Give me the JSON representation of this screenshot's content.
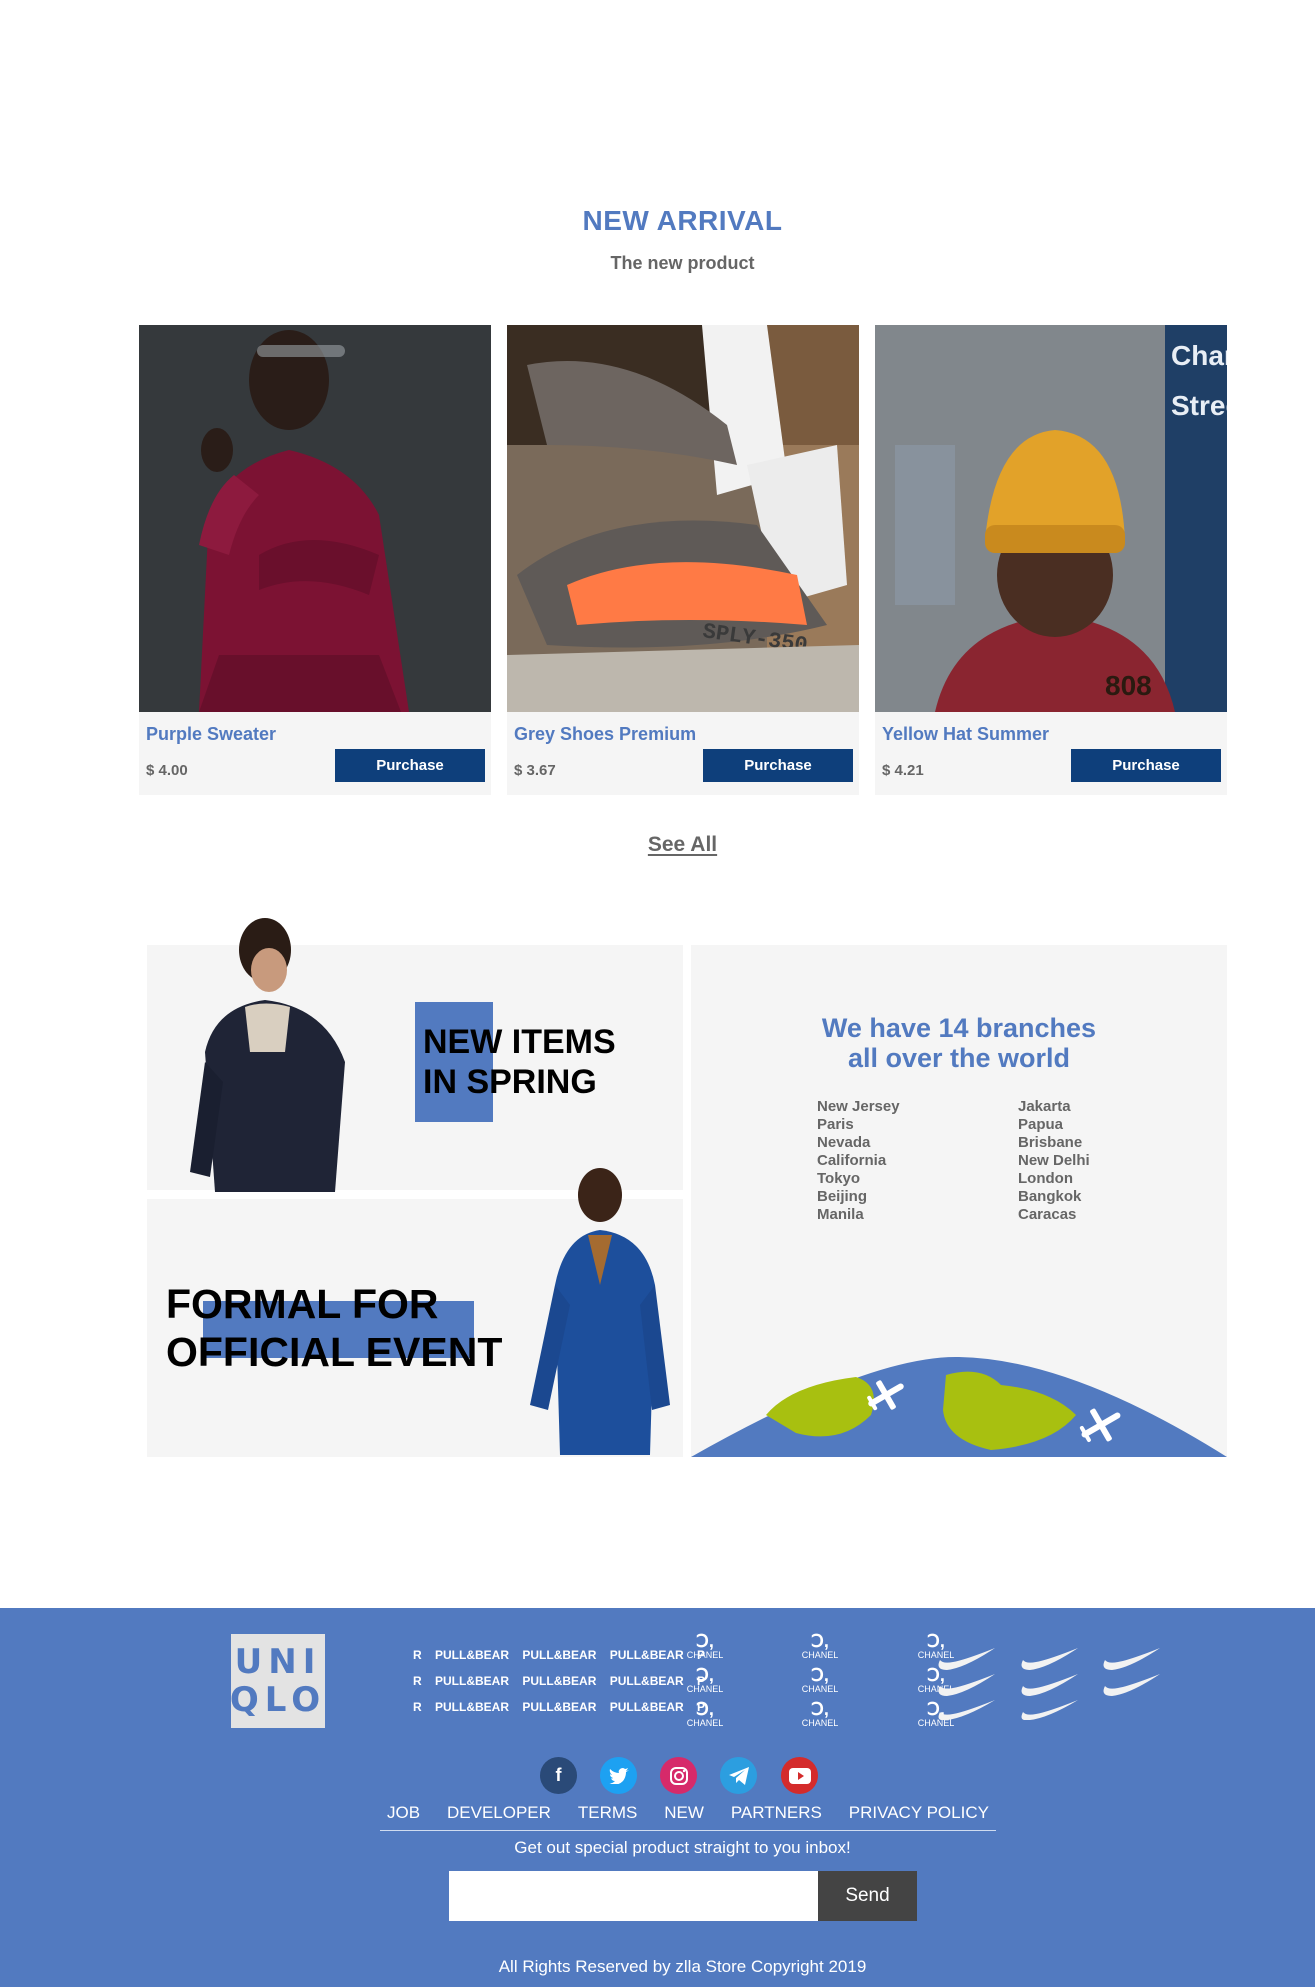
{
  "new_arrival": {
    "title": "NEW ARRIVAL",
    "subtitle": "The new product",
    "see_all": "See All"
  },
  "products": [
    {
      "name": "Purple Sweater",
      "price": "$ 4.00",
      "button": "Purchase"
    },
    {
      "name": "Grey Shoes Premium",
      "price": "$ 3.67",
      "button": "Purchase"
    },
    {
      "name": "Yellow Hat Summer",
      "price": "$ 4.21",
      "button": "Purchase"
    }
  ],
  "promo": {
    "spring_line1": "NEW ITEMS",
    "spring_line2": "IN SPRING",
    "formal_line1": "FORMAL FOR",
    "formal_line2": "OFFICIAL EVENT"
  },
  "branches": {
    "title_line1": "We have 14 branches",
    "title_line2": "all over the world",
    "col1": [
      "New Jersey",
      "Paris",
      "Nevada",
      "California",
      "Tokyo",
      "Beijing",
      "Manila"
    ],
    "col2": [
      "Jakarta",
      "Papua",
      "Brisbane",
      "New Delhi",
      "London",
      "Bangkok",
      "Caracas"
    ]
  },
  "footer": {
    "logo_line1": "UNI",
    "logo_line2": "QLO",
    "brands": {
      "pullbear": "PULL&BEAR",
      "pullbear_cut_left": "R",
      "pullbear_cut_right": "P",
      "chanel": "CHANEL"
    },
    "links": [
      "JOB",
      "DEVELOPER",
      "TERMS",
      "NEW",
      "PARTNERS",
      "PRIVACY POLICY"
    ],
    "tagline": "Get out special product straight to you inbox!",
    "email_placeholder": "",
    "send_label": "Send",
    "copyright": "All Rights Reserved by zlla Store Copyright 2019"
  },
  "colors": {
    "accent": "#527ac0",
    "button": "#0e3f7b",
    "panel": "#f5f5f5",
    "dark_button": "#444444"
  },
  "icons": [
    "facebook-icon",
    "twitter-icon",
    "instagram-icon",
    "telegram-icon",
    "youtube-icon",
    "airplane-icon",
    "nike-swoosh-icon",
    "chanel-logo-icon"
  ]
}
